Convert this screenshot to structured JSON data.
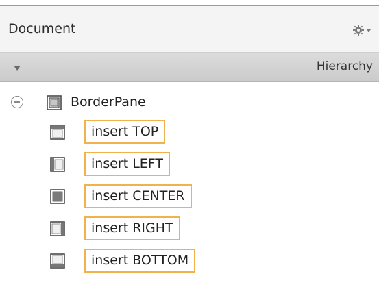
{
  "panel": {
    "title": "Document",
    "view_mode": "Hierarchy"
  },
  "tree": {
    "root": {
      "label": "BorderPane",
      "icon": "borderpane-icon",
      "expanded": true
    },
    "children": [
      {
        "label": "insert TOP",
        "icon": "border-top-region-icon"
      },
      {
        "label": "insert LEFT",
        "icon": "border-left-region-icon"
      },
      {
        "label": "insert CENTER",
        "icon": "border-center-region-icon"
      },
      {
        "label": "insert RIGHT",
        "icon": "border-right-region-icon"
      },
      {
        "label": "insert BOTTOM",
        "icon": "border-bottom-region-icon"
      }
    ]
  },
  "colors": {
    "insert_outline": "#f0b24a",
    "header_bg": "#f4f4f4",
    "subheader_bg": "#d3d3d3"
  }
}
